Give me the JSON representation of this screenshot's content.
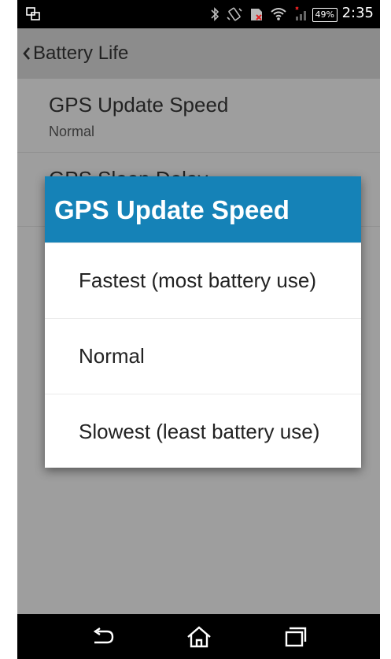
{
  "status_bar": {
    "battery_percent": "49%",
    "time": "2:35"
  },
  "action_bar": {
    "title": "Battery Life"
  },
  "preferences": [
    {
      "title": "GPS Update Speed",
      "summary": "Normal"
    },
    {
      "title": "GPS Sleep Delay",
      "summary": ""
    }
  ],
  "dialog": {
    "title": "GPS Update Speed",
    "options": [
      {
        "label": "Fastest (most battery use)"
      },
      {
        "label": "Normal"
      },
      {
        "label": "Slowest (least battery use)"
      }
    ]
  },
  "colors": {
    "dialog_header": "#1582b7",
    "status_bar": "#000000",
    "action_bar": "#cfcfcf"
  },
  "icons": [
    "screen-share-icon",
    "bluetooth-icon",
    "vibrate-icon",
    "sim-icon",
    "wifi-icon",
    "signal-icon",
    "back-icon",
    "home-icon",
    "recents-icon"
  ]
}
